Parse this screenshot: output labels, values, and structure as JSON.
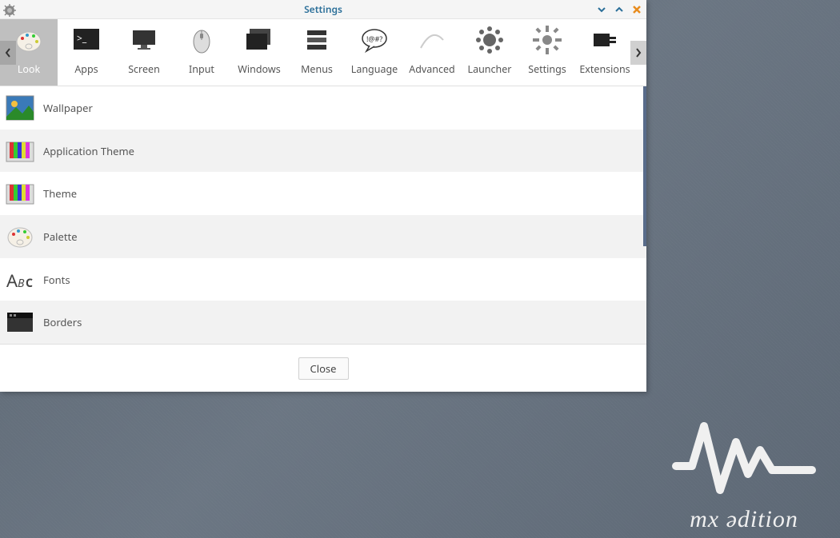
{
  "window": {
    "title": "Settings"
  },
  "tabs": [
    {
      "label": "Look"
    },
    {
      "label": "Apps"
    },
    {
      "label": "Screen"
    },
    {
      "label": "Input"
    },
    {
      "label": "Windows"
    },
    {
      "label": "Menus"
    },
    {
      "label": "Language"
    },
    {
      "label": "Advanced"
    },
    {
      "label": "Launcher"
    },
    {
      "label": "Settings"
    },
    {
      "label": "Extensions"
    }
  ],
  "rows": [
    {
      "label": "Wallpaper"
    },
    {
      "label": "Application Theme"
    },
    {
      "label": "Theme"
    },
    {
      "label": "Palette"
    },
    {
      "label": "Fonts"
    },
    {
      "label": "Borders"
    }
  ],
  "footer": {
    "close": "Close"
  },
  "branding": {
    "line": "mx ədition"
  }
}
